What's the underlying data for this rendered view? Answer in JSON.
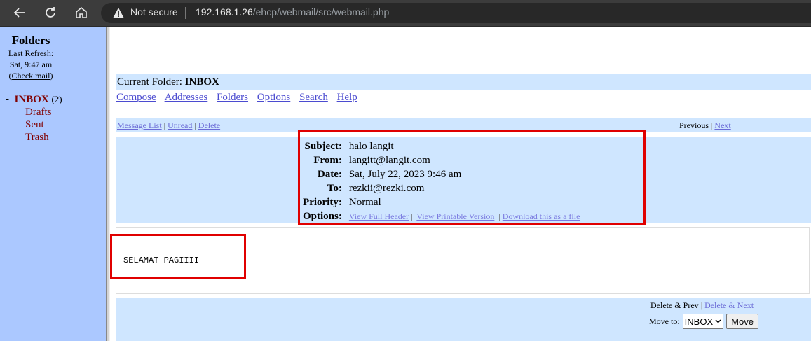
{
  "browser": {
    "security_label": "Not secure",
    "url_host": "192.168.1.26",
    "url_path": "/ehcp/webmail/src/webmail.php"
  },
  "sidebar": {
    "title": "Folders",
    "last_refresh_label": "Last Refresh:",
    "last_refresh_time": "Sat, 9:47 am",
    "check_mail": "Check mail",
    "inbox_label": "INBOX",
    "inbox_count": "(2)",
    "folders": [
      "Drafts",
      "Sent",
      "Trash"
    ]
  },
  "main": {
    "current_folder_label": "Current Folder:",
    "current_folder": "INBOX",
    "menu": [
      "Compose",
      "Addresses",
      "Folders",
      "Options",
      "Search",
      "Help"
    ],
    "nav_left": [
      "Message List",
      "Unread",
      "Delete"
    ],
    "nav_previous": "Previous",
    "nav_next": "Next",
    "headers": {
      "subject_label": "Subject:",
      "subject": "halo langit",
      "from_label": "From:",
      "from": "langitt@langit.com",
      "date_label": "Date:",
      "date": "Sat, July 22, 2023 9:46 am",
      "to_label": "To:",
      "to": "rezkii@rezki.com",
      "priority_label": "Priority:",
      "priority": "Normal",
      "options_label": "Options:",
      "options": [
        "View Full Header",
        "View Printable Version",
        "Download this as a file"
      ]
    },
    "body": "SELAMAT PAGIIII",
    "bottom": {
      "delete_prev": "Delete & Prev",
      "delete_next": "Delete & Next",
      "move_to_label": "Move to:",
      "move_folder": "INBOX",
      "move_button": "Move"
    }
  },
  "colors": {
    "annotation": "#e00000",
    "sidebar_bg": "#abc8ff",
    "bar_bg": "#cfe6ff"
  }
}
